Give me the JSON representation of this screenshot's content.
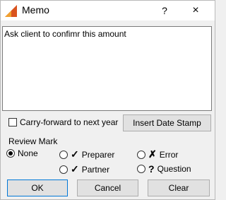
{
  "window": {
    "title": "Memo",
    "help_label": "?",
    "close_label": "×"
  },
  "memo": {
    "text": "Ask client to confimr this amount"
  },
  "carry_forward": {
    "label": "Carry-forward to next year",
    "checked": false
  },
  "insert_date_stamp": {
    "label": "Insert Date Stamp"
  },
  "review_mark": {
    "label": "Review Mark",
    "options": [
      {
        "label": "None",
        "mark": "",
        "selected": true
      },
      {
        "label": "Preparer",
        "mark": "✓",
        "selected": false
      },
      {
        "label": "Error",
        "mark": "✗",
        "selected": false
      },
      {
        "label": "Partner",
        "mark": "✓",
        "selected": false
      },
      {
        "label": "Question",
        "mark": "?",
        "selected": false
      }
    ]
  },
  "buttons": {
    "ok": "OK",
    "cancel": "Cancel",
    "clear": "Clear"
  }
}
